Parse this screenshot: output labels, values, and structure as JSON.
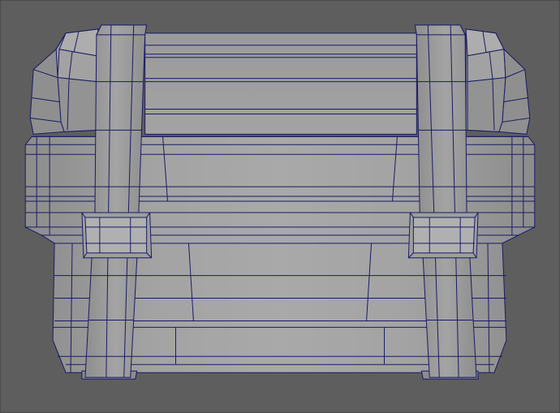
{
  "viewport": {
    "background_color": "#5e5e5e",
    "wire_color": "#1a1a66"
  },
  "model": {
    "subject": "treasure-chest",
    "display_mode": "wireframe-on-shaded",
    "material_colors": {
      "light": "#a6a6a6",
      "mid": "#979797",
      "dark": "#8a8a8a",
      "shadow": "#7a7a7a"
    }
  }
}
